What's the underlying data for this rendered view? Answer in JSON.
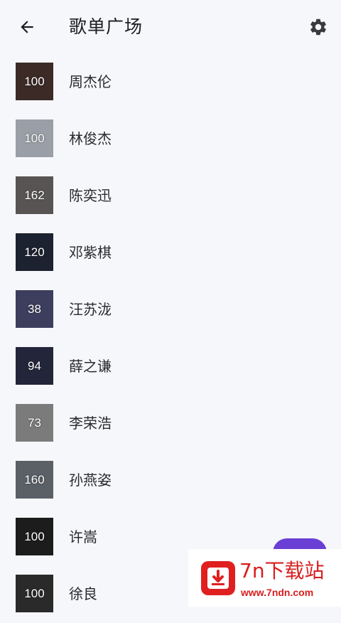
{
  "header": {
    "title": "歌单广场",
    "back_icon": "arrow-left-icon",
    "settings_icon": "gear-icon"
  },
  "playlists": [
    {
      "name": "周杰伦",
      "count": "100",
      "thumb_color": "#3b2a26"
    },
    {
      "name": "林俊杰",
      "count": "100",
      "thumb_color": "#9a9ea6"
    },
    {
      "name": "陈奕迅",
      "count": "162",
      "thumb_color": "#585454"
    },
    {
      "name": "邓紫棋",
      "count": "120",
      "thumb_color": "#1d2230"
    },
    {
      "name": "汪苏泷",
      "count": "38",
      "thumb_color": "#3d3e5e"
    },
    {
      "name": "薛之谦",
      "count": "94",
      "thumb_color": "#23263a"
    },
    {
      "name": "李荣浩",
      "count": "73",
      "thumb_color": "#7b7b7b"
    },
    {
      "name": "孙燕姿",
      "count": "160",
      "thumb_color": "#5b5f66"
    },
    {
      "name": "许嵩",
      "count": "100",
      "thumb_color": "#1c1c1c"
    },
    {
      "name": "徐良",
      "count": "100",
      "thumb_color": "#2a2a2a"
    }
  ],
  "fab": {
    "color": "#6a3fd6"
  },
  "watermark": {
    "name": "7n下载站",
    "url": "www.7ndn.com",
    "color": "#d81e1e"
  }
}
